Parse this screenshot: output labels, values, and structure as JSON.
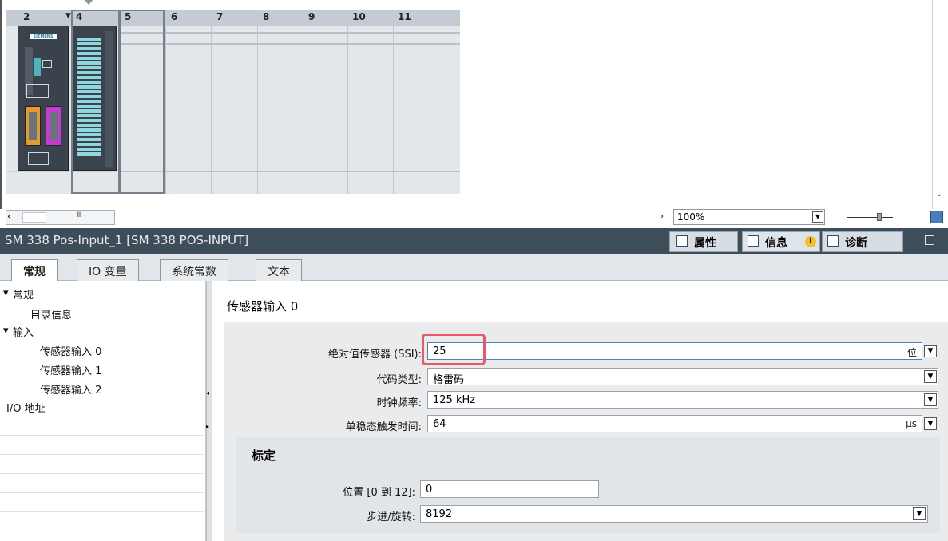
{
  "rack": {
    "slots": [
      "2",
      "4",
      "5",
      "6",
      "7",
      "8",
      "9",
      "10",
      "11"
    ],
    "ps_brand": "SIEMENS"
  },
  "zoom": {
    "value": "100%"
  },
  "panel": {
    "title": "SM 338 Pos-Input_1 [SM 338 POS-INPUT]",
    "tabs": {
      "properties": "属性",
      "info": "信息",
      "diagnostics": "诊断"
    }
  },
  "subtabs": [
    "常规",
    "IO 变量",
    "系统常数",
    "文本"
  ],
  "nav": {
    "general": "常规",
    "catalog": "目录信息",
    "input": "输入",
    "sensor0": "传感器输入 0",
    "sensor1": "传感器输入 1",
    "sensor2": "传感器输入 2",
    "io_address": "I/O 地址"
  },
  "section": {
    "title": "传感器输入 0",
    "scaling_title": "标定"
  },
  "fields": {
    "absolute_sensor": {
      "label": "绝对值传感器 (SSI):",
      "value": "25",
      "unit": "位"
    },
    "code_type": {
      "label": "代码类型:",
      "value": "格雷码"
    },
    "clock_freq": {
      "label": "时钟频率:",
      "value": "125 kHz"
    },
    "monoflop": {
      "label": "单稳态触发时间:",
      "value": "64",
      "unit": "μs"
    },
    "position": {
      "label": "位置 [0 到 12]:",
      "value": "0"
    },
    "steps": {
      "label": "步进/旋转:",
      "value": "8192"
    }
  }
}
